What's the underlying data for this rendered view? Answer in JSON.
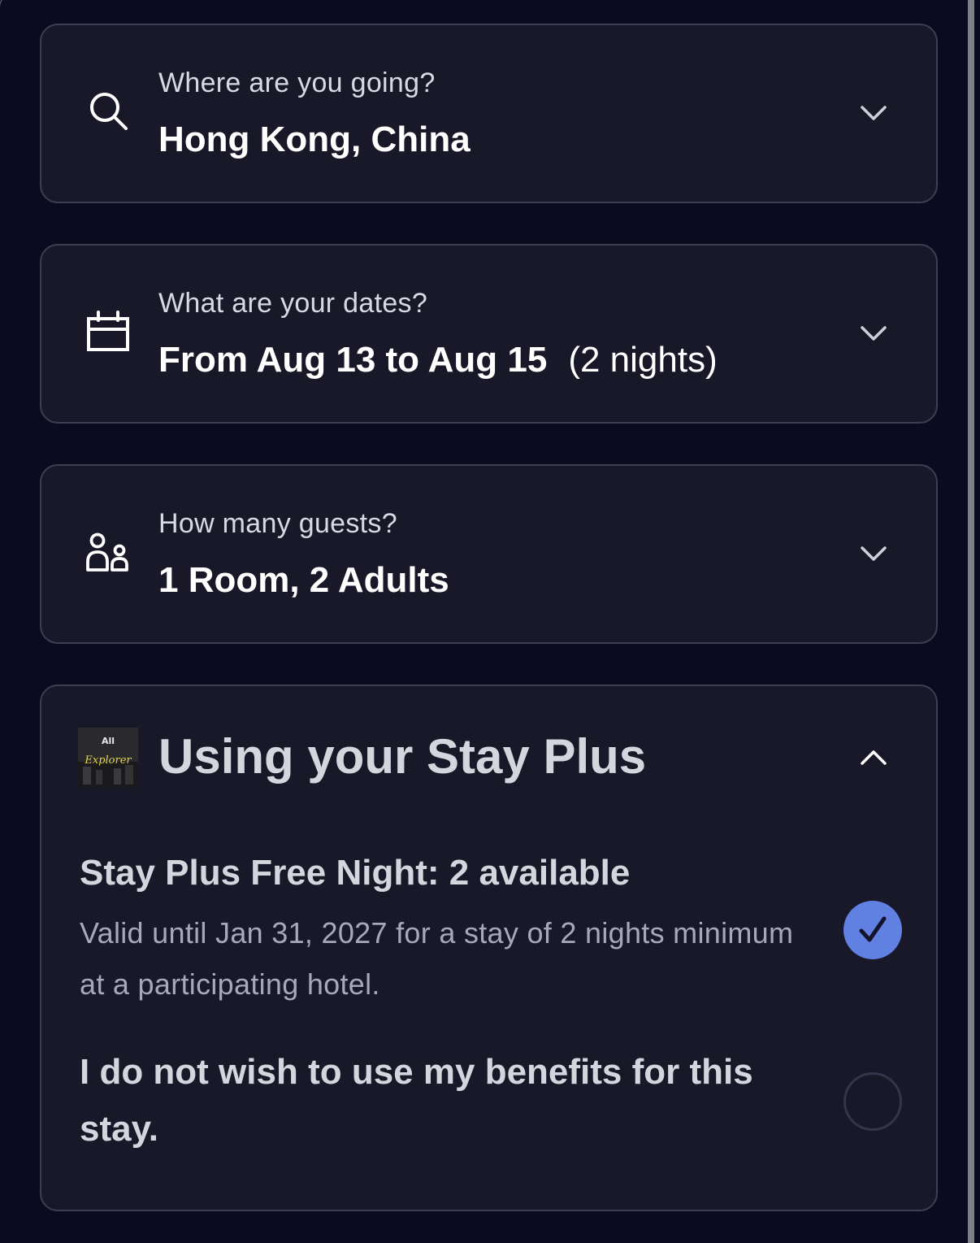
{
  "destination": {
    "label": "Where are you going?",
    "value": "Hong Kong, China",
    "icon": "search-icon"
  },
  "dates": {
    "label": "What are your dates?",
    "value": "From Aug 13 to Aug 15",
    "nights": "(2 nights)",
    "icon": "calendar-icon"
  },
  "guests": {
    "label": "How many guests?",
    "value": "1 Room, 2 Adults",
    "icon": "guests-icon"
  },
  "stay_plus": {
    "title": "Using your Stay Plus",
    "logo_text_top": "All",
    "logo_text_script": "Explorer",
    "benefit": {
      "title": "Stay Plus Free Night: 2 available",
      "description": "Valid until Jan 31, 2027 for a stay of 2 nights minimum at a participating hotel.",
      "selected": true
    },
    "opt_out": {
      "label": "I do not wish to use my benefits for this stay.",
      "selected": false
    }
  },
  "colors": {
    "background": "#0b0a1e",
    "card": "#181829",
    "card_border": "#3e3e52",
    "accent": "#6080e2"
  }
}
